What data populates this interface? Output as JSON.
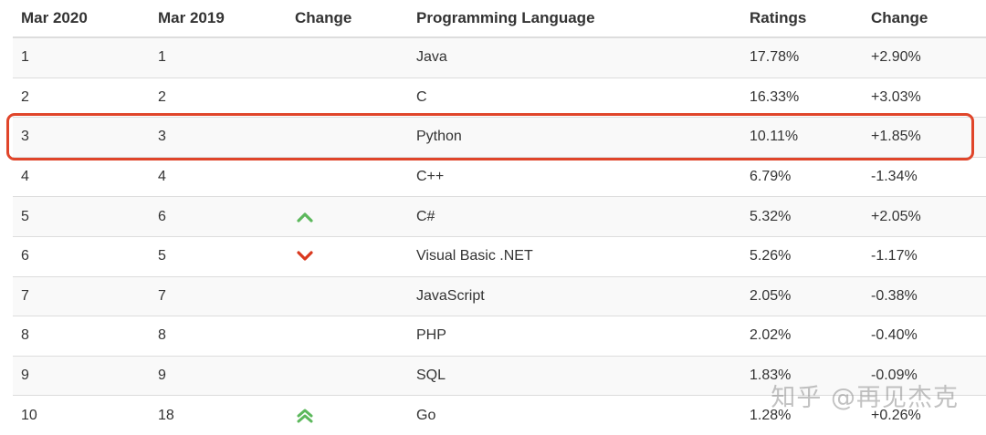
{
  "table": {
    "headers": [
      "Mar 2020",
      "Mar 2019",
      "Change",
      "Programming Language",
      "Ratings",
      "Change"
    ],
    "rows": [
      {
        "mar2020": "1",
        "mar2019": "1",
        "trend": "",
        "language": "Java",
        "rating": "17.78%",
        "change": "+2.90%"
      },
      {
        "mar2020": "2",
        "mar2019": "2",
        "trend": "",
        "language": "C",
        "rating": "16.33%",
        "change": "+3.03%"
      },
      {
        "mar2020": "3",
        "mar2019": "3",
        "trend": "",
        "language": "Python",
        "rating": "10.11%",
        "change": "+1.85%"
      },
      {
        "mar2020": "4",
        "mar2019": "4",
        "trend": "",
        "language": "C++",
        "rating": "6.79%",
        "change": "-1.34%"
      },
      {
        "mar2020": "5",
        "mar2019": "6",
        "trend": "up-chevron-icon",
        "language": "C#",
        "rating": "5.32%",
        "change": "+2.05%"
      },
      {
        "mar2020": "6",
        "mar2019": "5",
        "trend": "down-chevron-icon",
        "language": "Visual Basic .NET",
        "rating": "5.26%",
        "change": "-1.17%"
      },
      {
        "mar2020": "7",
        "mar2019": "7",
        "trend": "",
        "language": "JavaScript",
        "rating": "2.05%",
        "change": "-0.38%"
      },
      {
        "mar2020": "8",
        "mar2019": "8",
        "trend": "",
        "language": "PHP",
        "rating": "2.02%",
        "change": "-0.40%"
      },
      {
        "mar2020": "9",
        "mar2019": "9",
        "trend": "",
        "language": "SQL",
        "rating": "1.83%",
        "change": "-0.09%"
      },
      {
        "mar2020": "10",
        "mar2019": "18",
        "trend": "double-up-chevron-icon",
        "language": "Go",
        "rating": "1.28%",
        "change": "+0.26%"
      }
    ]
  },
  "highlight": {
    "row": "Python",
    "color": "#e0452a"
  },
  "trend_colors": {
    "up": "#5cb85c",
    "down": "#d9381e"
  },
  "watermark": "知乎 @再见杰克"
}
